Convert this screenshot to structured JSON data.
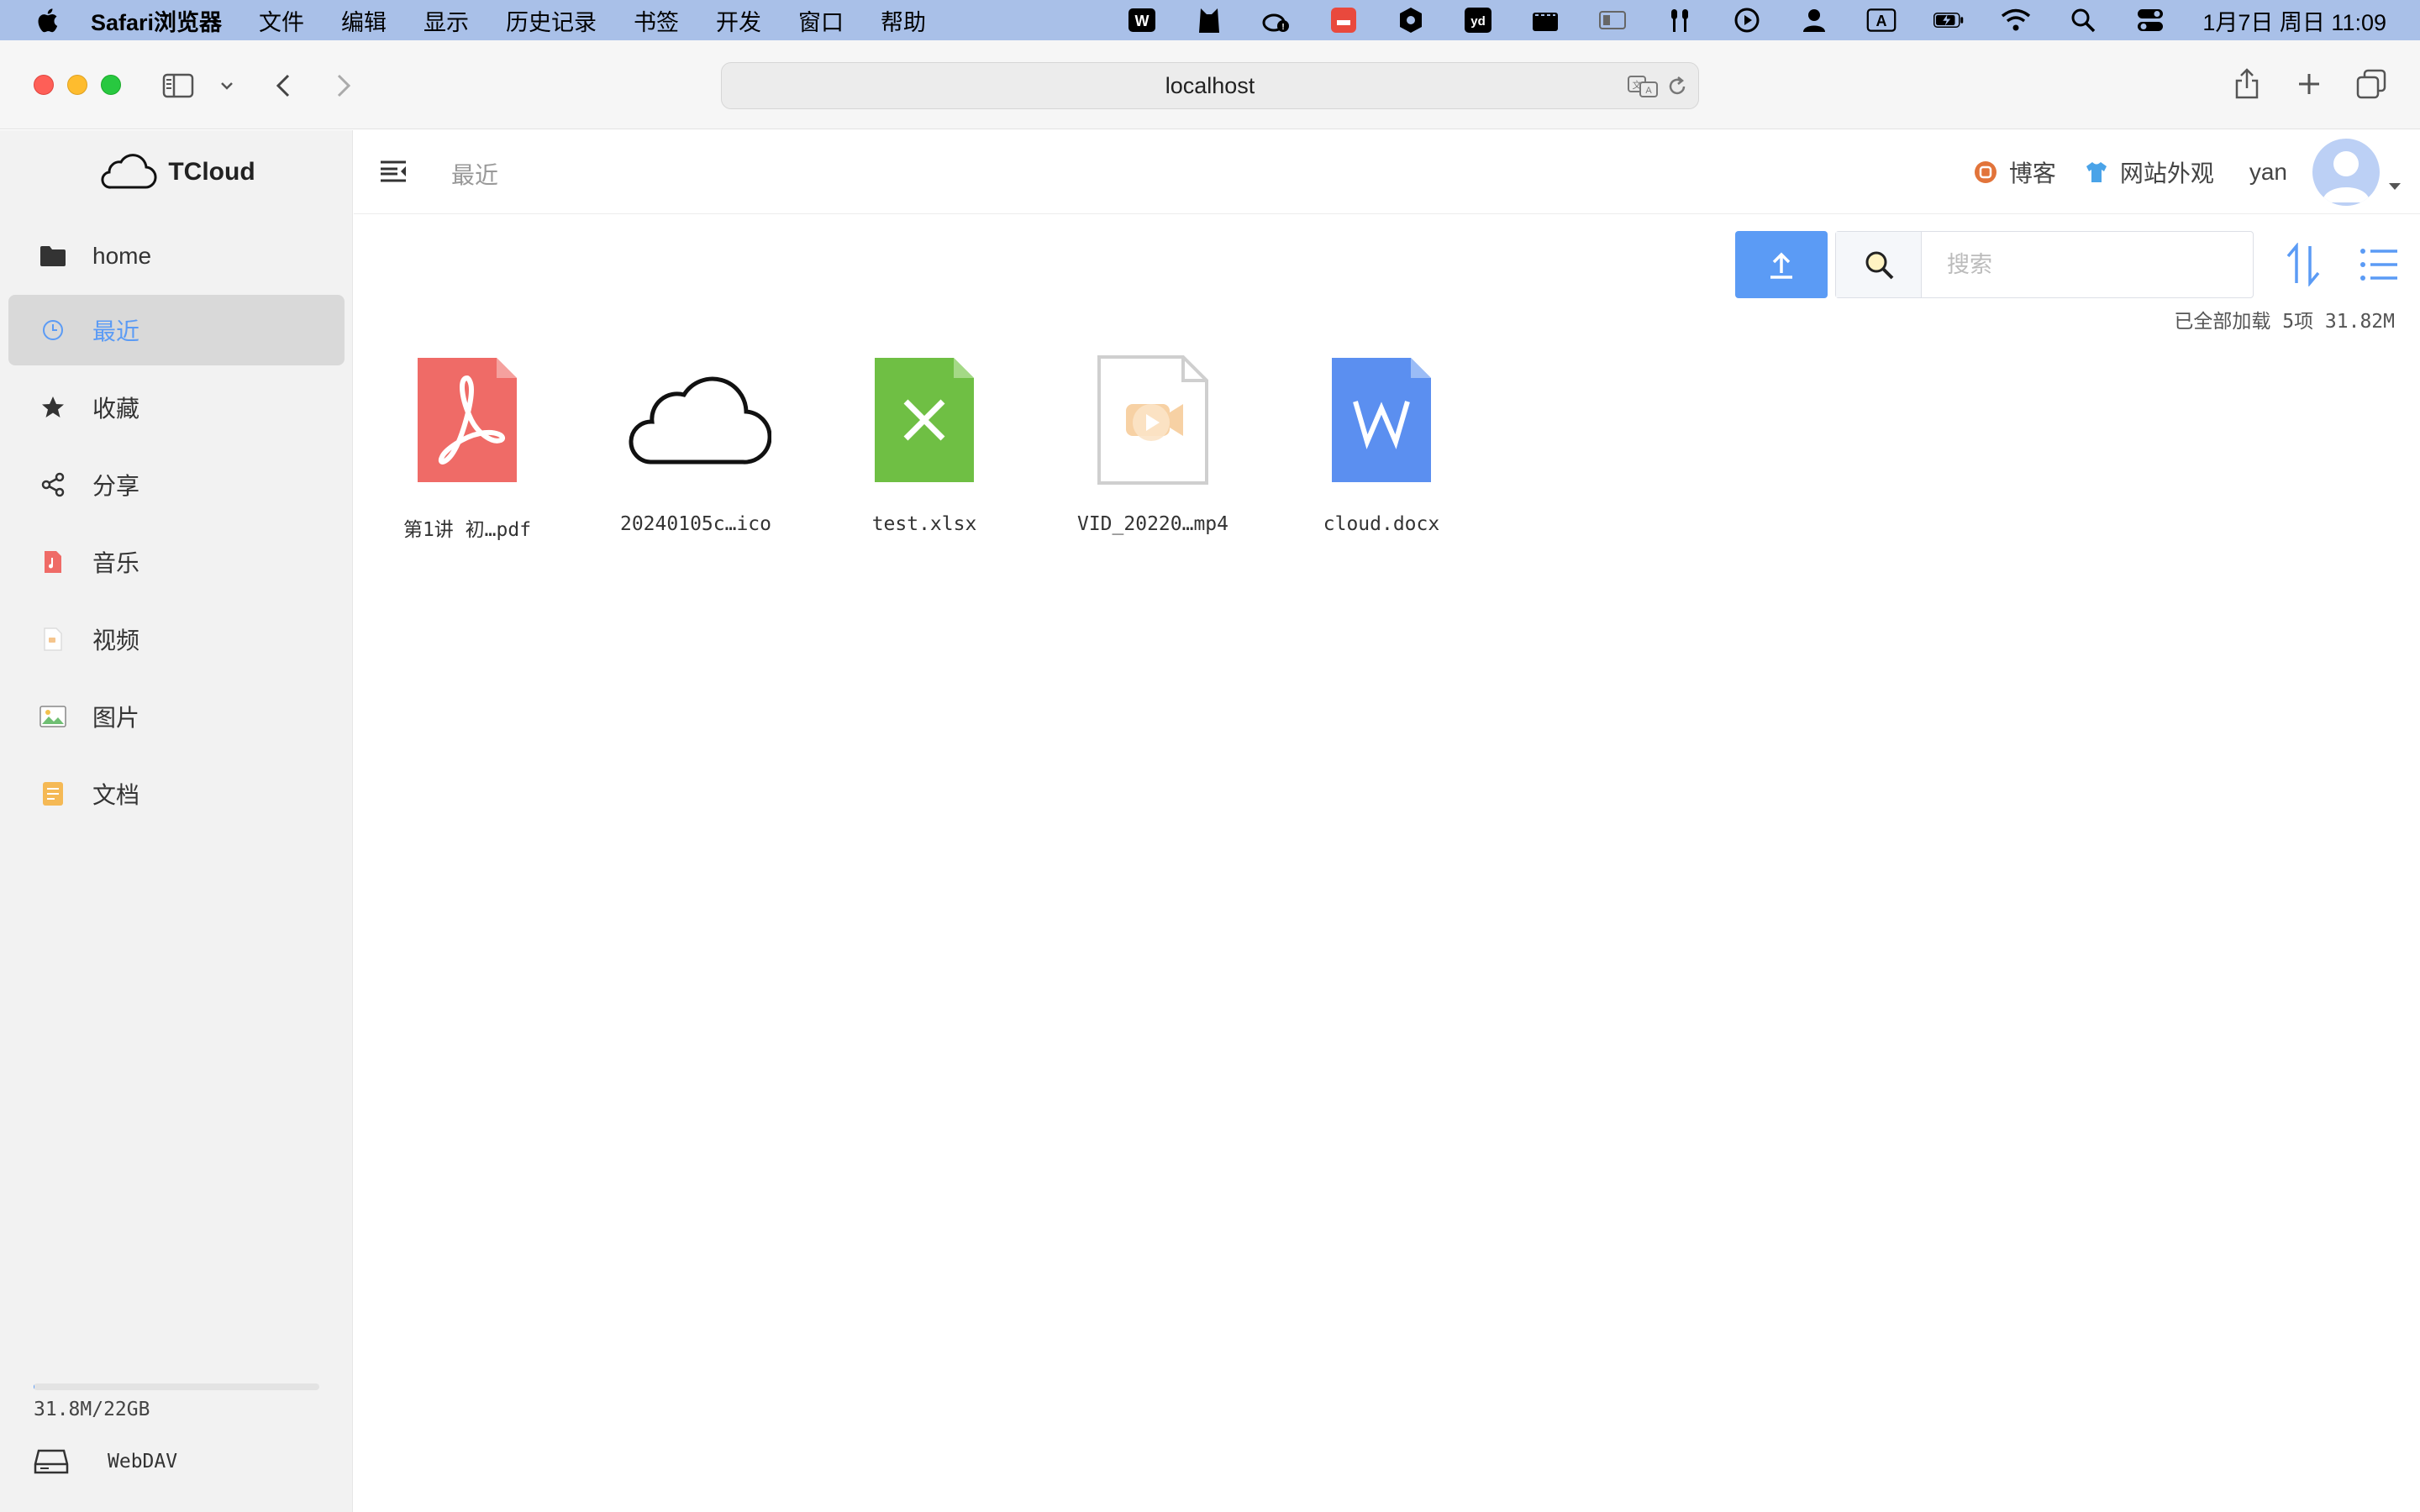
{
  "menubar": {
    "app_name": "Safari浏览器",
    "menus": [
      "文件",
      "编辑",
      "显示",
      "历史记录",
      "书签",
      "开发",
      "窗口",
      "帮助"
    ],
    "input_indicator": "A",
    "ime_indicator": "yd",
    "clock": "1月7日 周日 11:09"
  },
  "browser": {
    "address": "localhost"
  },
  "sidebar": {
    "brand": "TCloud",
    "items": [
      {
        "label": "home",
        "icon": "folder-icon",
        "active": false
      },
      {
        "label": "最近",
        "icon": "clock-icon",
        "active": true
      },
      {
        "label": "收藏",
        "icon": "star-icon",
        "active": false
      },
      {
        "label": "分享",
        "icon": "share-icon",
        "active": false
      },
      {
        "label": "音乐",
        "icon": "music-icon",
        "active": false
      },
      {
        "label": "视频",
        "icon": "video-icon",
        "active": false
      },
      {
        "label": "图片",
        "icon": "image-icon",
        "active": false
      },
      {
        "label": "文档",
        "icon": "document-icon",
        "active": false
      }
    ],
    "storage_text": "31.8M/22GB",
    "storage_fraction": 0.0014,
    "webdav_label": "WebDAV"
  },
  "header": {
    "breadcrumb": "最近",
    "blog_label": "博客",
    "appearance_label": "网站外观",
    "username": "yan"
  },
  "toolbar": {
    "search_placeholder": "搜索",
    "load_status": "已全部加载 5项 31.82M"
  },
  "files": [
    {
      "name": "第1讲 初…pdf",
      "type": "pdf"
    },
    {
      "name": "20240105c…ico",
      "type": "ico"
    },
    {
      "name": "test.xlsx",
      "type": "xlsx"
    },
    {
      "name": "VID_20220…mp4",
      "type": "mp4"
    },
    {
      "name": "cloud.docx",
      "type": "docx"
    }
  ],
  "colors": {
    "accent": "#5b9bf5",
    "pdf": "#ef6b67",
    "xlsx": "#6fbf44",
    "docx": "#5b8ff0",
    "video": "#f5c58d"
  }
}
